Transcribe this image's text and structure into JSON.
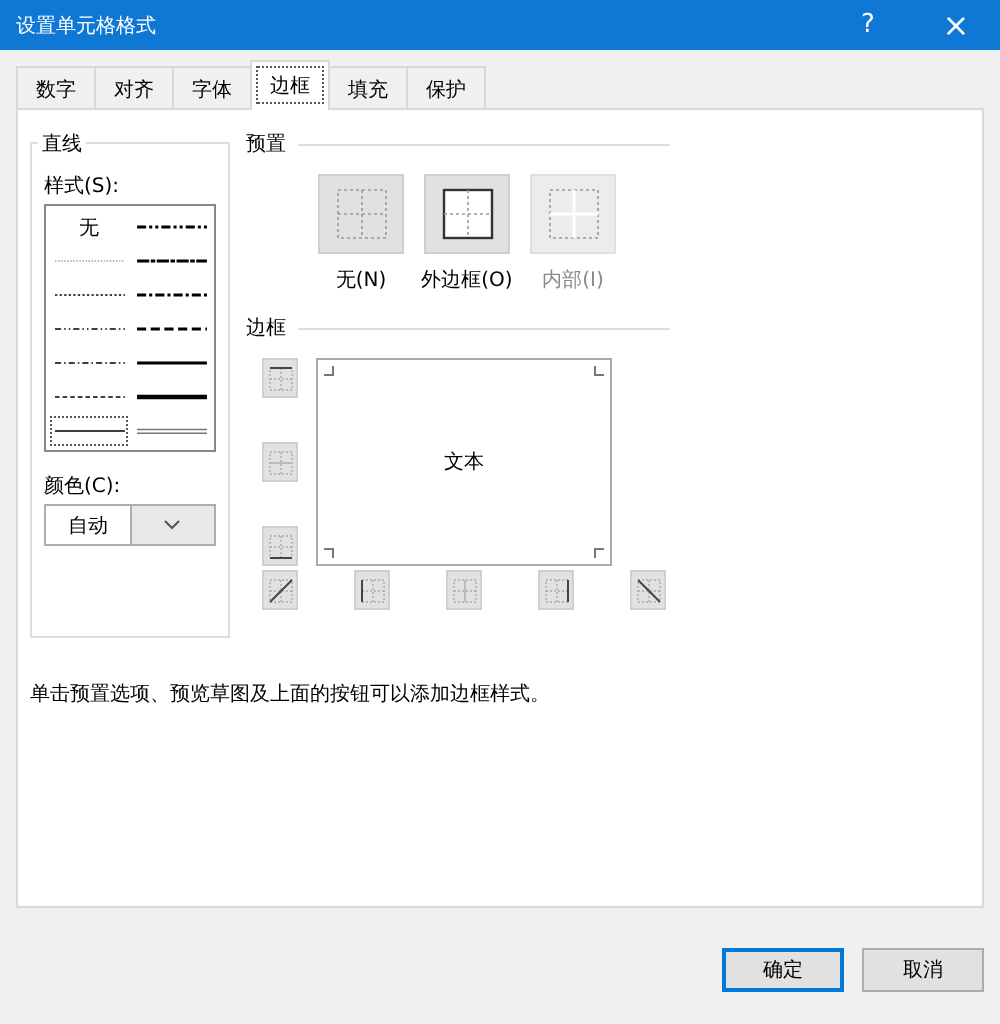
{
  "window": {
    "title": "设置单元格格式",
    "help": "?",
    "close": "×"
  },
  "tabs": [
    {
      "label": "数字",
      "selected": false
    },
    {
      "label": "对齐",
      "selected": false
    },
    {
      "label": "字体",
      "selected": false
    },
    {
      "label": "边框",
      "selected": true
    },
    {
      "label": "填充",
      "selected": false
    },
    {
      "label": "保护",
      "selected": false
    }
  ],
  "line": {
    "title": "直线",
    "style_label": "样式(S):",
    "styles": [
      {
        "kind": "none",
        "label": "无",
        "selected": false
      },
      {
        "kind": "hair",
        "selected": false
      },
      {
        "kind": "dotted",
        "selected": false
      },
      {
        "kind": "dashdotdot",
        "selected": false
      },
      {
        "kind": "dashdot",
        "selected": false
      },
      {
        "kind": "dashed",
        "selected": false
      },
      {
        "kind": "thin",
        "selected": true
      },
      {
        "kind": "mediumdashdotdot",
        "selected": false
      },
      {
        "kind": "slantdashdot",
        "selected": false
      },
      {
        "kind": "mediumdashdot",
        "selected": false
      },
      {
        "kind": "mediumdashed",
        "selected": false
      },
      {
        "kind": "medium",
        "selected": false
      },
      {
        "kind": "thick",
        "selected": false
      },
      {
        "kind": "double",
        "selected": false
      }
    ],
    "color_label": "颜色(C):",
    "color_value": "自动"
  },
  "presets": {
    "title": "预置",
    "items": [
      {
        "kind": "none",
        "label": "无(N)",
        "disabled": false
      },
      {
        "kind": "outline",
        "label": "外边框(O)",
        "disabled": false
      },
      {
        "kind": "inside",
        "label": "内部(I)",
        "disabled": true
      }
    ]
  },
  "border": {
    "title": "边框",
    "preview_text": "文本",
    "buttons": [
      {
        "kind": "top",
        "disabled": false
      },
      {
        "kind": "middle-h",
        "disabled": true
      },
      {
        "kind": "bottom",
        "disabled": false
      },
      {
        "kind": "diag-up",
        "disabled": false
      },
      {
        "kind": "left",
        "disabled": false
      },
      {
        "kind": "middle-v",
        "disabled": true
      },
      {
        "kind": "right",
        "disabled": false
      },
      {
        "kind": "diag-down",
        "disabled": false
      }
    ]
  },
  "hint": "单击预置选项、预览草图及上面的按钮可以添加边框样式。",
  "buttons": [
    {
      "label": "确定",
      "default": true
    },
    {
      "label": "取消",
      "default": false
    }
  ]
}
